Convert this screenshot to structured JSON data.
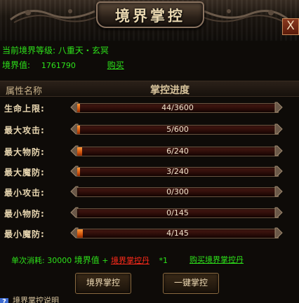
{
  "window": {
    "title": "境界掌控",
    "close_label": "X"
  },
  "info": {
    "current_level_label": "当前境界等级:",
    "current_level_value": "八重天・玄冥",
    "realm_value_label": "境界值:",
    "realm_value": "1761790",
    "buy_link": "购买"
  },
  "table": {
    "header_name": "属性名称",
    "header_progress": "掌控进度",
    "rows": [
      {
        "label": "生命上限:",
        "current": 44,
        "max": 3600,
        "text": "44/3600"
      },
      {
        "label": "最大攻击:",
        "current": 5,
        "max": 600,
        "text": "5/600"
      },
      {
        "label": "最大物防:",
        "current": 6,
        "max": 240,
        "text": "6/240"
      },
      {
        "label": "最大魔防:",
        "current": 3,
        "max": 240,
        "text": "3/240"
      },
      {
        "label": "最小攻击:",
        "current": 0,
        "max": 300,
        "text": "0/300"
      },
      {
        "label": "最小物防:",
        "current": 0,
        "max": 145,
        "text": "0/145"
      },
      {
        "label": "最小魔防:",
        "current": 4,
        "max": 145,
        "text": "4/145"
      }
    ]
  },
  "cost": {
    "prefix": "单次消耗:",
    "amount": "30000",
    "realm_word": "境界值",
    "plus": "+",
    "item_name": "境界掌控丹",
    "multiplier": "*1",
    "buy_item_link": "购买境界掌控丹"
  },
  "buttons": {
    "control": "境界掌控",
    "one_click": "一键掌控"
  },
  "help": {
    "icon": "?",
    "text": "境界掌控说明"
  },
  "colors": {
    "info_green": "#2de31a",
    "item_red": "#ff2a1a",
    "bar_fill": "#d2540c"
  }
}
